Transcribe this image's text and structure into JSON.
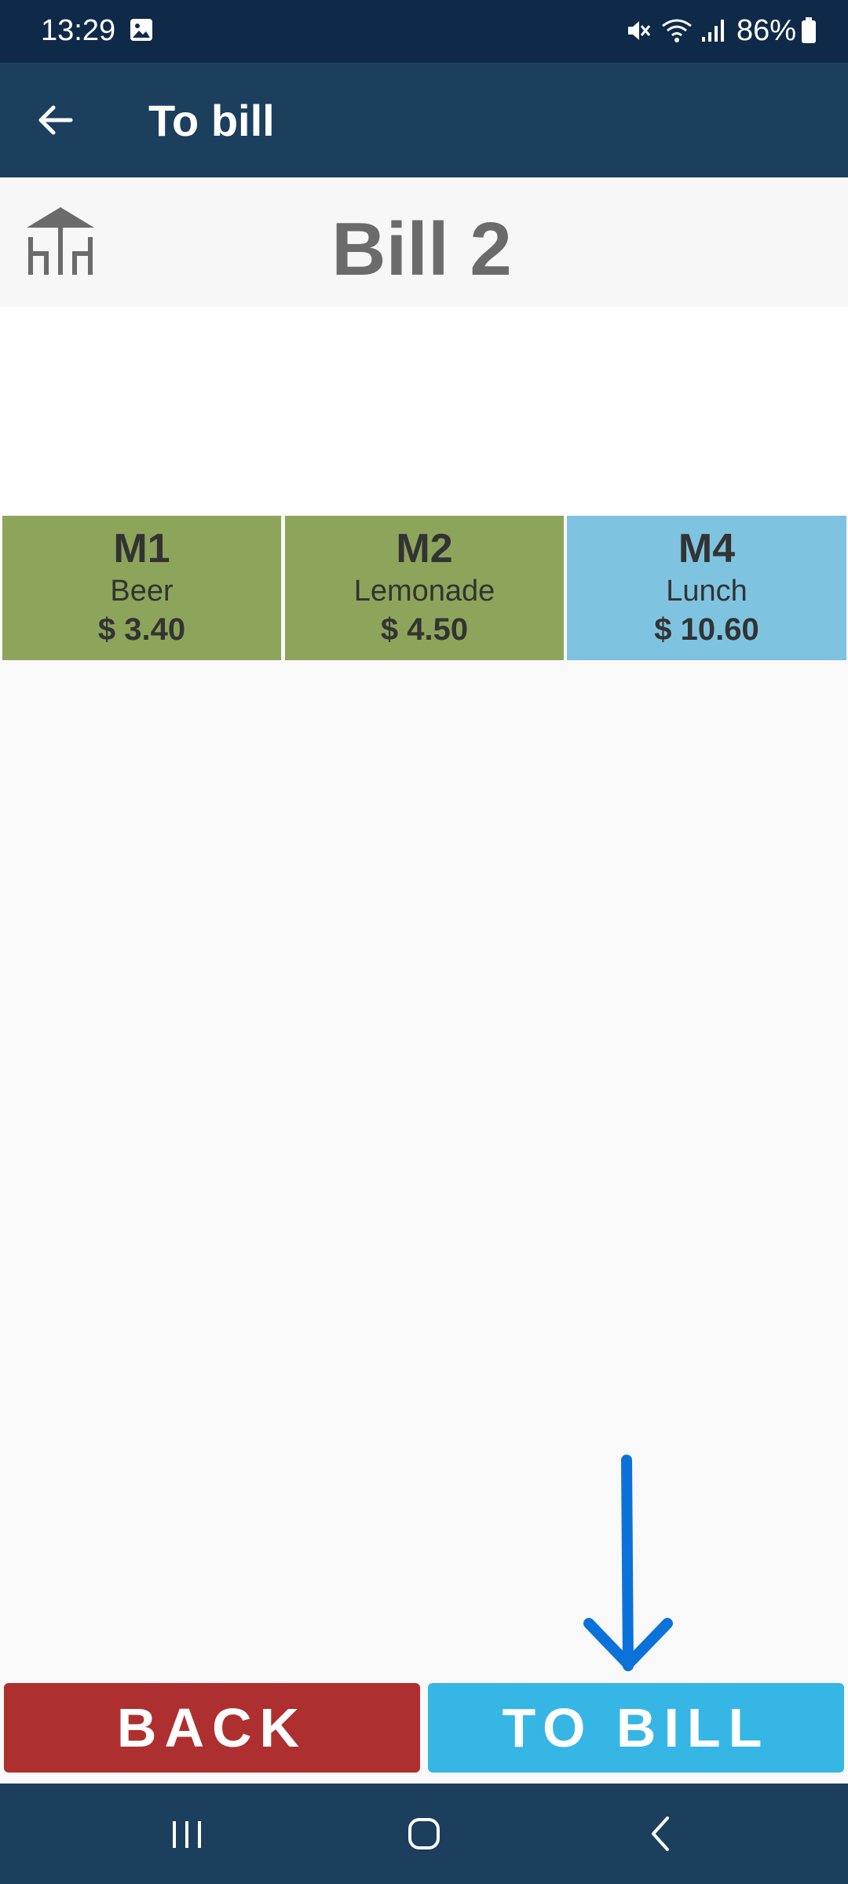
{
  "status_bar": {
    "time": "13:29",
    "battery": "86%"
  },
  "app_bar": {
    "title": "To bill"
  },
  "bill": {
    "title": "Bill 2"
  },
  "items": [
    {
      "code": "M1",
      "name": "Beer",
      "price": "$ 3.40",
      "color": "#8da55a"
    },
    {
      "code": "M2",
      "name": "Lemonade",
      "price": "$ 4.50",
      "color": "#8da55a"
    },
    {
      "code": "M4",
      "name": "Lunch",
      "price": "$ 10.60",
      "color": "#7ec4e0"
    }
  ],
  "buttons": {
    "back": "BACK",
    "to_bill": "TO BILL"
  },
  "colors": {
    "status_bar": "#0f2a48",
    "app_bar": "#1b3f5d",
    "back_button": "#ae2f2f",
    "to_bill_button": "#35b6e4",
    "annotation_arrow": "#0b72d9"
  },
  "icons": {
    "back": "arrow-left-icon",
    "table": "table-chairs-icon",
    "gallery": "image-icon",
    "mute": "mute-icon",
    "wifi": "wifi-icon",
    "signal": "signal-icon",
    "battery": "battery-icon",
    "recents": "recents-icon",
    "home": "home-icon",
    "nav_back": "nav-back-icon"
  }
}
